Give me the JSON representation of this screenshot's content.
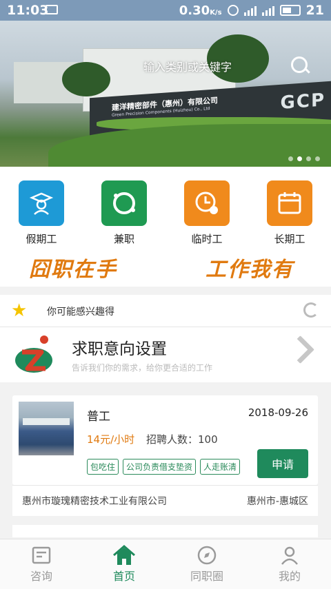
{
  "status": {
    "time": "11:03",
    "speed": "0.30",
    "speed_unit": "K/s",
    "battery": "21"
  },
  "banner": {
    "search_placeholder": "输入类别或关键字",
    "slides": 4,
    "active_slide": 2,
    "sign_text": "建洋精密部件（惠州）有限公司",
    "sign_text_en": "Green Precision Components (Huizhou) Co., Ltd",
    "sign_logo": "GCP"
  },
  "categories": [
    {
      "label": "假期工",
      "icon": "graduate-icon",
      "color": "#1e9ad6"
    },
    {
      "label": "兼职",
      "icon": "ring-icon",
      "color": "#1f9a52"
    },
    {
      "label": "临时工",
      "icon": "clock-icon",
      "color": "#f08a1c"
    },
    {
      "label": "长期工",
      "icon": "calendar-icon",
      "color": "#f08a1c"
    }
  ],
  "slogan": {
    "left": "囧职在手",
    "right": "工作我有"
  },
  "interest": {
    "title": "你可能感兴趣得"
  },
  "intent": {
    "title": "求职意向设置",
    "subtitle": "告诉我们你的需求，给你更合适的工作"
  },
  "job": {
    "title": "普工",
    "date": "2018-09-26",
    "wage": "14元/小时",
    "count": "招聘人数：100",
    "tags": [
      "包吃住",
      "公司负责借支垫资",
      "人走账清"
    ],
    "apply": "申请",
    "company": "惠州市璇瑰精密技术工业有限公司",
    "location": "惠州市-惠城区"
  },
  "tabs": [
    {
      "label": "咨询",
      "icon": "news-icon",
      "active": false
    },
    {
      "label": "首页",
      "icon": "home-icon",
      "active": true
    },
    {
      "label": "同职圈",
      "icon": "compass-icon",
      "active": false
    },
    {
      "label": "我的",
      "icon": "user-icon",
      "active": false
    }
  ],
  "colors": {
    "accent": "#1f8a5c",
    "orange": "#e07a10",
    "statusbar": "#7d9ab8"
  }
}
